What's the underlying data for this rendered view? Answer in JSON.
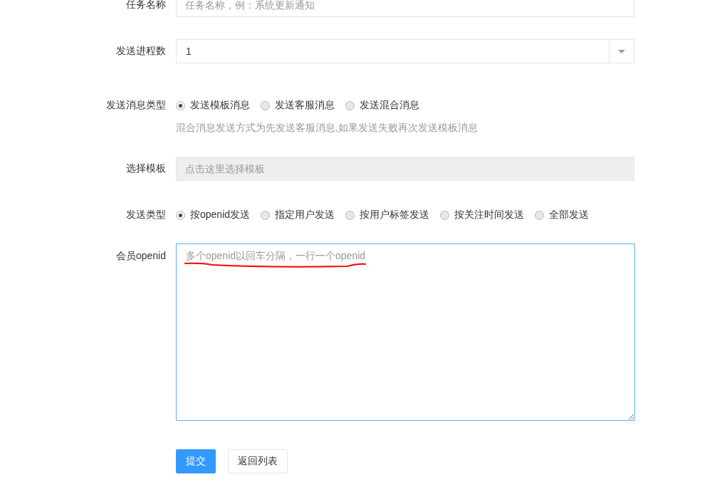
{
  "task_name": {
    "label": "任务名称",
    "placeholder": "任务名称，例：系统更新通知"
  },
  "process_count": {
    "label": "发送进程数",
    "value": "1"
  },
  "message_type": {
    "label": "发送消息类型",
    "options": [
      {
        "label": "发送模板消息",
        "selected": true
      },
      {
        "label": "发送客服消息",
        "selected": false
      },
      {
        "label": "发送混合消息",
        "selected": false
      }
    ],
    "hint": "混合消息发送方式为先发送客服消息,如果发送失败再次发送模板消息"
  },
  "template": {
    "label": "选择模板",
    "placeholder": "点击这里选择模板"
  },
  "send_type": {
    "label": "发送类型",
    "options": [
      {
        "label": "按openid发送",
        "selected": true
      },
      {
        "label": "指定用户发送",
        "selected": false
      },
      {
        "label": "按用户标签发送",
        "selected": false
      },
      {
        "label": "按关注时间发送",
        "selected": false
      },
      {
        "label": "全部发送",
        "selected": false
      }
    ]
  },
  "openid": {
    "label": "会员openid",
    "placeholder": "多个openid以回车分隔，一行一个openid"
  },
  "buttons": [
    {
      "label": "提交",
      "kind": "primary"
    },
    {
      "label": "返回列表",
      "kind": "default"
    }
  ]
}
